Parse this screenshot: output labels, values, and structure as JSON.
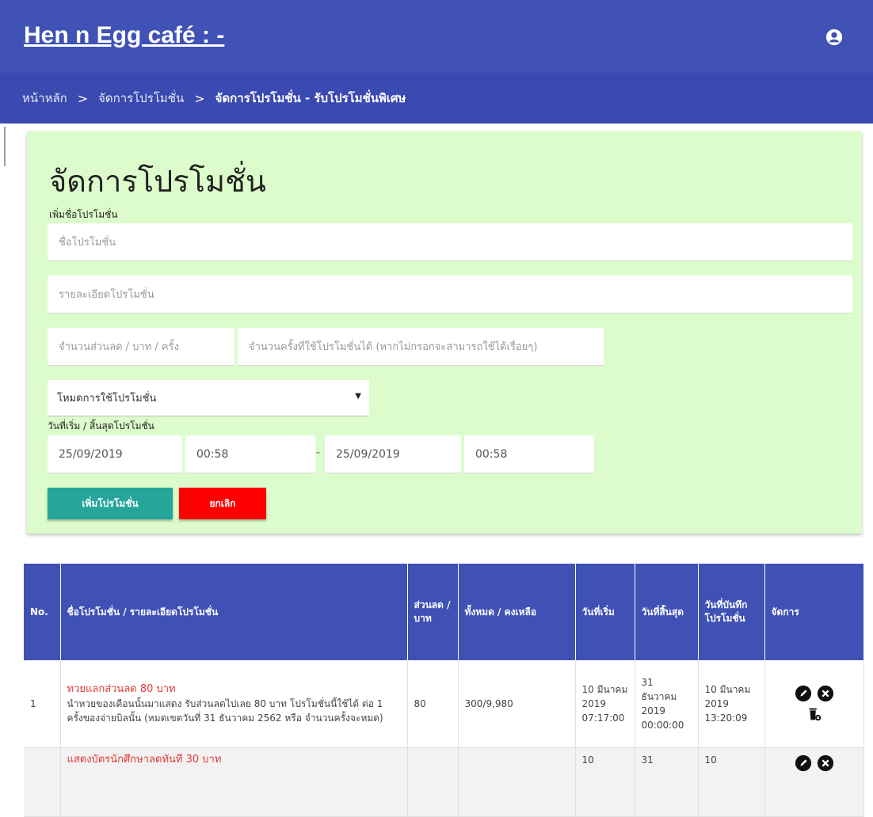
{
  "app": {
    "title": "Hen n Egg café : -"
  },
  "breadcrumb": [
    "หน้าหลัก",
    "จัดการโปรโมชั่น",
    "จัดการโปรโมชั่น - รับโปรโมชั่นพิเศษ"
  ],
  "form": {
    "heading": "จัดการโปรโมชั่น",
    "name_label": "เพิ่มชื่อโปรโมชั่น",
    "name_placeholder": "ชื่อโปรโมชั่น",
    "detail_placeholder": "รายละเอียดโปรโมชั่น",
    "discount_placeholder": "จำนวนส่วนลด / บาท / ครั้ง",
    "uses_placeholder": "จำนวนครั้งที่ใช้โปรโมชั่นได้ (หากไม่กรอกจะสามารถใช้ได้เรื่อยๆ)",
    "mode_selected": "โหมดการใช้โปรโมชั่น",
    "date_label": "วันที่เริ่ม / สิ้นสุดโปรโมชั่น",
    "start_date": "25/09/2019",
    "start_time": "00:58",
    "end_date": "25/09/2019",
    "end_time": "00:58",
    "dash": "-",
    "add_button": "เพิ่มโปรโมชั่น",
    "cancel_button": "ยกเลิก"
  },
  "colors": {
    "primary": "#3f51b5",
    "panel": "#dcfdcb",
    "add": "#26a69a",
    "cancel": "#ff0000",
    "promo_name": "#e53935"
  },
  "table": {
    "headers": [
      "No.",
      "ชื่อโปรโมชั่น / รายละเอียดโปรโมชั่น",
      "ส่วนลด / บาท",
      "ทั้งหมด / คงเหลือ",
      "วันที่เริ่ม",
      "วันที่สิ้นสุด",
      "วันที่บันทึกโปรโมชั่น",
      "จัดการ"
    ],
    "rows": [
      {
        "no": "1",
        "name": "ทวยแลกส่วนลด 80 บาท",
        "detail": "นำหวยของเดือนนั้นมาแสดง รับส่วนลดไปเลย 80 บาท โปรโมชั่นนี้ใช้ได้ ต่อ 1 ครั้งของจ่ายบิลนั้น (หมดเขตวันที่ 31 ธันวาคม 2562 หรือ จำนวนครั้งจะหมด)",
        "discount": "80",
        "total_remaining": "300/9,980",
        "start": "10 มีนาคม 2019 07:17:00",
        "end": "31 ธันวาคม 2019 00:00:00",
        "recorded": "10 มีนาคม 2019 13:20:09"
      },
      {
        "no": "",
        "name": "แสดงบัตรนักศึกษาลดทันที 30 บาท",
        "detail": "",
        "discount": "",
        "total_remaining": "",
        "start": "10",
        "end": "31",
        "recorded": "10"
      }
    ],
    "actions": [
      "pencil-icon",
      "close-circle-icon",
      "delete-icon"
    ]
  }
}
